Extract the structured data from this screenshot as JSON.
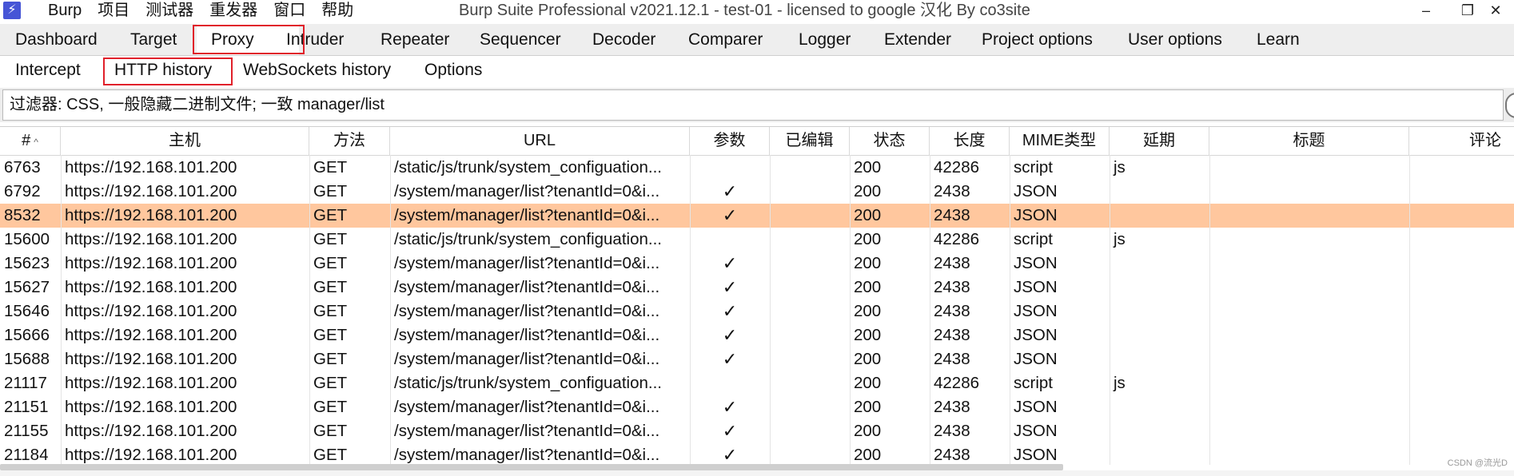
{
  "menubar": {
    "app_name": "Burp",
    "items": [
      "项目",
      "测试器",
      "重发器",
      "窗口",
      "帮助"
    ],
    "window_title": "Burp Suite Professional v2021.12.1 - test-01 - licensed to google 汉化 By co3site"
  },
  "window_controls": {
    "minimize": "–",
    "restore": "❐",
    "close": "✕"
  },
  "tabs": [
    "Dashboard",
    "Target",
    "Proxy",
    "Intruder",
    "Repeater",
    "Sequencer",
    "Decoder",
    "Comparer",
    "Logger",
    "Extender",
    "Project options",
    "User options",
    "Learn"
  ],
  "active_tab": "Proxy",
  "subtabs": [
    "Intercept",
    "HTTP history",
    "WebSockets history",
    "Options"
  ],
  "active_subtab": "HTTP history",
  "filter": {
    "text": "过滤器: CSS, 一般隐藏二进制文件; 一致 manager/list"
  },
  "table": {
    "columns": [
      "#",
      "主机",
      "方法",
      "URL",
      "参数",
      "已编辑",
      "状态",
      "长度",
      "MIME类型",
      "延期",
      "标题",
      "评论"
    ],
    "sort_indicator": "^",
    "selected_row_index": 2,
    "rows": [
      {
        "id": "6763",
        "host": "https://192.168.101.200",
        "method": "GET",
        "url": "/static/js/trunk/system_configuation...",
        "params": "",
        "edited": "",
        "status": "200",
        "length": "42286",
        "mime": "script",
        "ext": "js",
        "title": "",
        "comment": ""
      },
      {
        "id": "6792",
        "host": "https://192.168.101.200",
        "method": "GET",
        "url": "/system/manager/list?tenantId=0&i...",
        "params": "✓",
        "edited": "",
        "status": "200",
        "length": "2438",
        "mime": "JSON",
        "ext": "",
        "title": "",
        "comment": ""
      },
      {
        "id": "8532",
        "host": "https://192.168.101.200",
        "method": "GET",
        "url": "/system/manager/list?tenantId=0&i...",
        "params": "✓",
        "edited": "",
        "status": "200",
        "length": "2438",
        "mime": "JSON",
        "ext": "",
        "title": "",
        "comment": ""
      },
      {
        "id": "15600",
        "host": "https://192.168.101.200",
        "method": "GET",
        "url": "/static/js/trunk/system_configuation...",
        "params": "",
        "edited": "",
        "status": "200",
        "length": "42286",
        "mime": "script",
        "ext": "js",
        "title": "",
        "comment": ""
      },
      {
        "id": "15623",
        "host": "https://192.168.101.200",
        "method": "GET",
        "url": "/system/manager/list?tenantId=0&i...",
        "params": "✓",
        "edited": "",
        "status": "200",
        "length": "2438",
        "mime": "JSON",
        "ext": "",
        "title": "",
        "comment": ""
      },
      {
        "id": "15627",
        "host": "https://192.168.101.200",
        "method": "GET",
        "url": "/system/manager/list?tenantId=0&i...",
        "params": "✓",
        "edited": "",
        "status": "200",
        "length": "2438",
        "mime": "JSON",
        "ext": "",
        "title": "",
        "comment": ""
      },
      {
        "id": "15646",
        "host": "https://192.168.101.200",
        "method": "GET",
        "url": "/system/manager/list?tenantId=0&i...",
        "params": "✓",
        "edited": "",
        "status": "200",
        "length": "2438",
        "mime": "JSON",
        "ext": "",
        "title": "",
        "comment": ""
      },
      {
        "id": "15666",
        "host": "https://192.168.101.200",
        "method": "GET",
        "url": "/system/manager/list?tenantId=0&i...",
        "params": "✓",
        "edited": "",
        "status": "200",
        "length": "2438",
        "mime": "JSON",
        "ext": "",
        "title": "",
        "comment": ""
      },
      {
        "id": "15688",
        "host": "https://192.168.101.200",
        "method": "GET",
        "url": "/system/manager/list?tenantId=0&i...",
        "params": "✓",
        "edited": "",
        "status": "200",
        "length": "2438",
        "mime": "JSON",
        "ext": "",
        "title": "",
        "comment": ""
      },
      {
        "id": "21117",
        "host": "https://192.168.101.200",
        "method": "GET",
        "url": "/static/js/trunk/system_configuation...",
        "params": "",
        "edited": "",
        "status": "200",
        "length": "42286",
        "mime": "script",
        "ext": "js",
        "title": "",
        "comment": ""
      },
      {
        "id": "21151",
        "host": "https://192.168.101.200",
        "method": "GET",
        "url": "/system/manager/list?tenantId=0&i...",
        "params": "✓",
        "edited": "",
        "status": "200",
        "length": "2438",
        "mime": "JSON",
        "ext": "",
        "title": "",
        "comment": ""
      },
      {
        "id": "21155",
        "host": "https://192.168.101.200",
        "method": "GET",
        "url": "/system/manager/list?tenantId=0&i...",
        "params": "✓",
        "edited": "",
        "status": "200",
        "length": "2438",
        "mime": "JSON",
        "ext": "",
        "title": "",
        "comment": ""
      },
      {
        "id": "21184",
        "host": "https://192.168.101.200",
        "method": "GET",
        "url": "/system/manager/list?tenantId=0&i...",
        "params": "✓",
        "edited": "",
        "status": "200",
        "length": "2438",
        "mime": "JSON",
        "ext": "",
        "title": "",
        "comment": ""
      }
    ]
  },
  "watermark": "CSDN @流光D",
  "colors": {
    "selected_row": "#ffc79e",
    "highlight_box": "#e0202a",
    "app_icon": "#4655d6"
  }
}
